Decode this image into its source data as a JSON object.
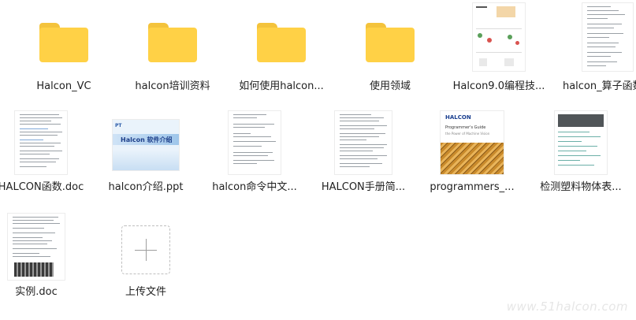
{
  "files": [
    {
      "name": "Halcon_VC",
      "type": "folder"
    },
    {
      "name": "halcon培训资料",
      "type": "folder"
    },
    {
      "name": "如何使用halcon...",
      "type": "folder"
    },
    {
      "name": "使用领域",
      "type": "folder"
    },
    {
      "name": "Halcon9.0编程技...",
      "type": "pdf"
    },
    {
      "name": "halcon_算子函数...",
      "type": "doc"
    },
    {
      "name": "HALCON函数.doc",
      "type": "doc"
    },
    {
      "name": "halcon介绍.ppt",
      "type": "ppt"
    },
    {
      "name": "halcon命令中文...",
      "type": "doc"
    },
    {
      "name": "HALCON手册简...",
      "type": "doc"
    },
    {
      "name": "programmers_...",
      "type": "pdf"
    },
    {
      "name": "检测塑料物体表...",
      "type": "doc"
    },
    {
      "name": "实例.doc",
      "type": "doc"
    }
  ],
  "upload": {
    "label": "上传文件"
  },
  "thumbs": {
    "ppt_title": "Halcon 软件介绍",
    "ppt_logo": "PT",
    "guide_brand": "HALCON",
    "guide_title": "Programmer's Guide",
    "guide_sub": "the Power of Machine Vision"
  },
  "watermark": "www.51halcon.com",
  "colors": {
    "folder": "#ffd146",
    "folder_tab": "#f4c33c"
  }
}
